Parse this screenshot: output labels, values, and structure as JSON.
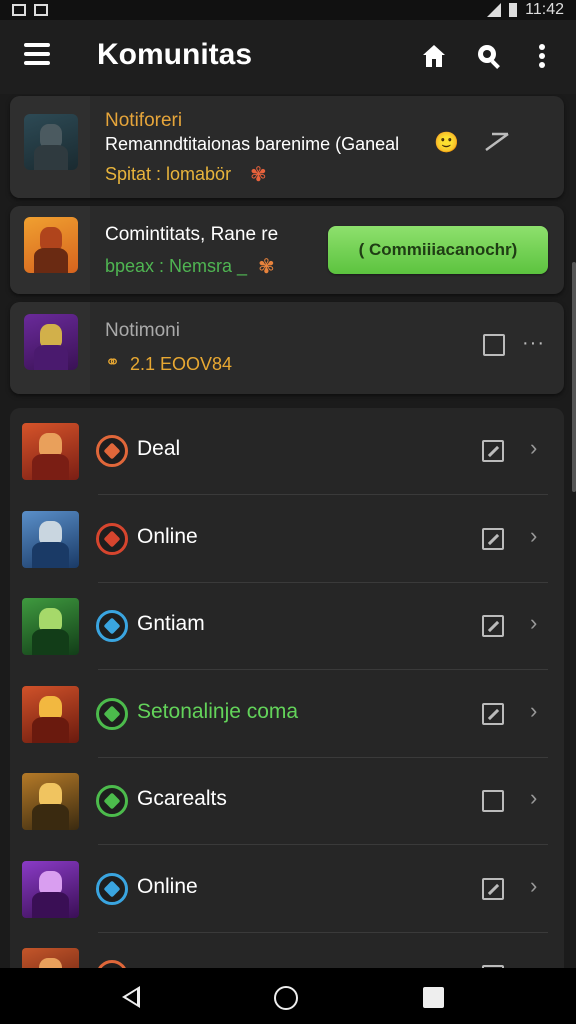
{
  "status_bar": {
    "time": "11:42"
  },
  "app_bar": {
    "title": "Komunitas"
  },
  "cards": [
    {
      "line1": "Notiforeri",
      "line2": "Remanndtitaionas barenime (Ganeal",
      "line3": "Spitat : lomabör",
      "line1_color": "#e6a53a",
      "line3_color": "#e8b43c"
    },
    {
      "line1": "Comintitats, Rane re",
      "line2": "bpeax : Nemsra _",
      "button_label": "( Commiiiacanochr)",
      "line1_color": "#ffffff",
      "line2_color": "#4fb552"
    },
    {
      "line1": "Notimoni",
      "line2": "2.1 EOOV84",
      "line1_color": "#aaaaaa",
      "line2_color": "#e8a832"
    }
  ],
  "list_rows": [
    {
      "label": "Deal",
      "label_color": "#ffffff",
      "checked": true,
      "icon_color": "#e0673a",
      "thumb": [
        "#7a1e14",
        "#d6542a",
        "#e9a05b"
      ]
    },
    {
      "label": "Online",
      "label_color": "#ffffff",
      "checked": true,
      "icon_color": "#d6452e",
      "thumb": [
        "#1a3a66",
        "#5a8fc9",
        "#c9d6e0"
      ]
    },
    {
      "label": "Gntiam",
      "label_color": "#ffffff",
      "checked": true,
      "icon_color": "#3aa5e0",
      "thumb": [
        "#123d18",
        "#3f9a3f",
        "#a6d96a"
      ]
    },
    {
      "label": "Setonalinje coma",
      "label_color": "#63d35a",
      "checked": true,
      "icon_color": "#4cbb4c",
      "thumb": [
        "#6a1a0e",
        "#d0522a",
        "#f2b840"
      ]
    },
    {
      "label": "Gcarealts",
      "label_color": "#ffffff",
      "checked": false,
      "icon_color": "#4cbb4c",
      "thumb": [
        "#3a2a10",
        "#b57a28",
        "#f0c460"
      ]
    },
    {
      "label": "Online",
      "label_color": "#ffffff",
      "checked": true,
      "icon_color": "#3aa5e0",
      "thumb": [
        "#3a0f55",
        "#8a3bc6",
        "#d99ef0"
      ]
    },
    {
      "label": "",
      "label_color": "#ffffff",
      "checked": true,
      "icon_color": "#e0673a",
      "thumb": [
        "#5a1a0e",
        "#c4562a",
        "#e9a05b"
      ]
    }
  ],
  "colors": {
    "background": "#1b1b1b",
    "card": "#2a2a2a",
    "accent_green": "#5cc33f"
  }
}
